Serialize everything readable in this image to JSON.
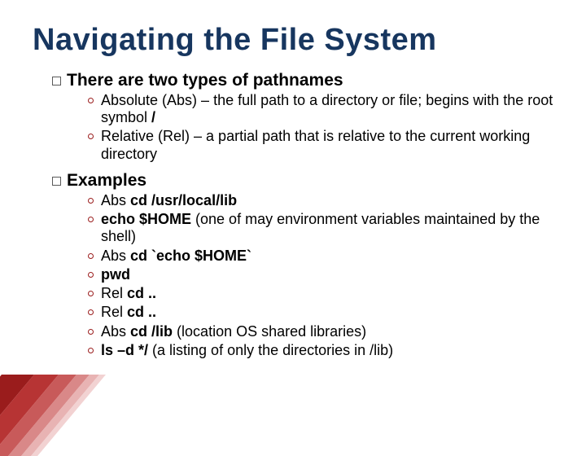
{
  "title": "Navigating the File System",
  "bullet1": {
    "heading": "There are two types of pathnames",
    "items": [
      {
        "pre": "Absolute (Abs) – the full path to a directory or file; begins with the root symbol ",
        "bold": "/"
      },
      {
        "pre": "Relative (Rel) – a partial path that is relative to the current working directory"
      }
    ]
  },
  "bullet2": {
    "heading": "Examples",
    "items": [
      {
        "pre": "Abs ",
        "bold": "cd /usr/local/lib"
      },
      {
        "bold": "echo $HOME",
        "post": " (one of may environment variables maintained by the shell)"
      },
      {
        "pre": "Abs ",
        "bold": "cd `echo $HOME`"
      },
      {
        "bold": "pwd"
      },
      {
        "pre": "Rel ",
        "bold": "cd .."
      },
      {
        "pre": "Rel ",
        "bold": "cd .."
      },
      {
        "pre": "Abs ",
        "bold": "cd /lib",
        "post": " (location OS shared libraries)"
      },
      {
        "bold": "ls –d */",
        "post": " (a listing of only the directories in /lib)"
      }
    ]
  }
}
